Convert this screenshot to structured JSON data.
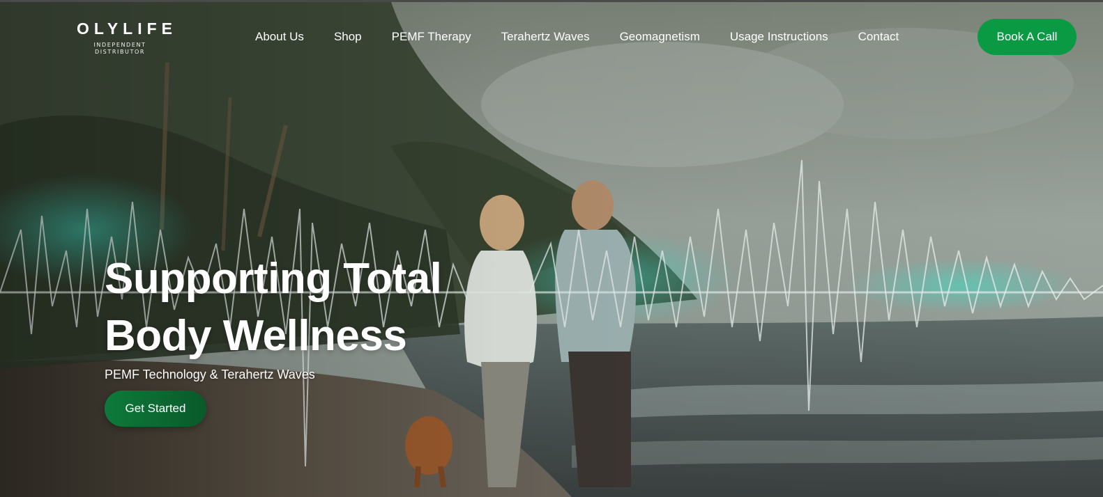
{
  "header": {
    "logo": {
      "name": "OLYLIFE",
      "tagline": "INDEPENDENT DISTRIBUTOR"
    },
    "nav": [
      {
        "label": "About Us"
      },
      {
        "label": "Shop"
      },
      {
        "label": "PEMF Therapy"
      },
      {
        "label": "Terahertz Waves"
      },
      {
        "label": "Geomagnetism"
      },
      {
        "label": "Usage Instructions"
      },
      {
        "label": "Contact"
      }
    ],
    "cta_label": "Book A Call"
  },
  "hero": {
    "title_line1": "Supporting Total",
    "title_line2": "Body Wellness",
    "subtitle": "PEMF Technology & Terahertz Waves",
    "button_label": "Get Started"
  },
  "colors": {
    "accent_green": "#0a9a44",
    "button_dark_green": "#0a5a2a",
    "text": "#ffffff"
  }
}
